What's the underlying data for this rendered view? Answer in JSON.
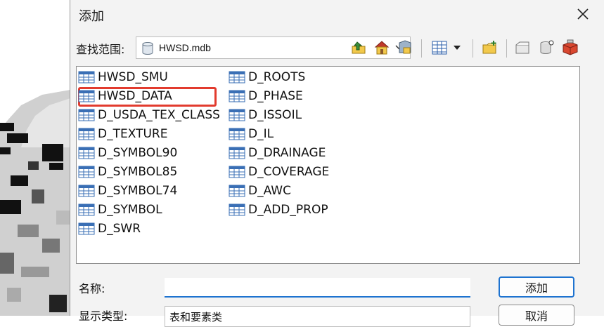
{
  "dialog": {
    "title": "添加"
  },
  "lookin": {
    "label": "查找范围:",
    "value": "HWSD.mdb"
  },
  "toolbar": {
    "icons": [
      "up-folder-icon",
      "home-icon",
      "connect-folder-icon",
      "view-list-icon",
      "view-dropdown-icon",
      "new-folder-icon",
      "new-database-icon",
      "refresh-icon",
      "toolbox-icon"
    ]
  },
  "file_list": {
    "items": [
      "HWSD_SMU",
      "HWSD_DATA",
      "D_USDA_TEX_CLASS",
      "D_TEXTURE",
      "D_SYMBOL90",
      "D_SYMBOL85",
      "D_SYMBOL74",
      "D_SYMBOL",
      "D_SWR",
      "D_ROOTS",
      "D_PHASE",
      "D_ISSOIL",
      "D_IL",
      "D_DRAINAGE",
      "D_COVERAGE",
      "D_AWC",
      "D_ADD_PROP"
    ],
    "highlighted": "HWSD_DATA"
  },
  "name_field": {
    "label": "名称:",
    "value": ""
  },
  "type_field": {
    "label": "显示类型:",
    "value": "表和要素类"
  },
  "buttons": {
    "add": "添加",
    "cancel": "取消"
  },
  "colors": {
    "highlight": "#e23b2e",
    "focus": "#1e73d0"
  }
}
